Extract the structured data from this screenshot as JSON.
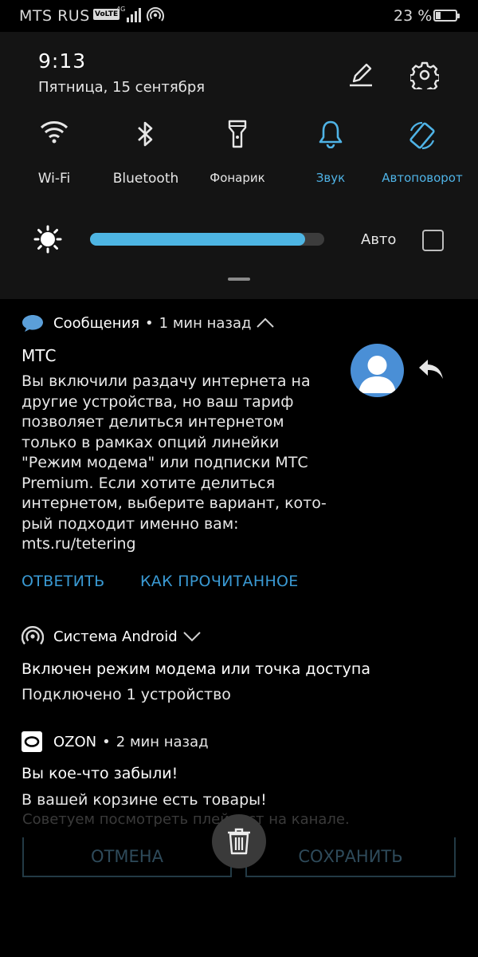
{
  "status_bar": {
    "carrier": "MTS RUS",
    "volte": "VoLTE",
    "network": "4G",
    "battery_percent": "23 %",
    "battery_level": 0.23
  },
  "quick_settings": {
    "time": "9:13",
    "date": "Пятница, 15 сентября",
    "tiles": [
      {
        "label": "Wi-Fi",
        "icon": "wifi-icon",
        "active": false
      },
      {
        "label": "Bluetooth",
        "icon": "bluetooth-icon",
        "active": false
      },
      {
        "label": "Фонарик",
        "icon": "flashlight-icon",
        "active": false
      },
      {
        "label": "Звук",
        "icon": "bell-icon",
        "active": true
      },
      {
        "label": "Автоповорот",
        "icon": "auto-rotate-icon",
        "active": true
      }
    ],
    "brightness_level": 0.92,
    "auto_label": "Авто",
    "auto_checked": false
  },
  "notifications": {
    "sms": {
      "app": "Сообщения",
      "time": "1 мин назад",
      "sender": "МТС",
      "body": "Вы включили раздачу интернета на другие устройства, но ваш тариф позволяет делиться интернетом только в рамках опций линейки \"Режим модема\" или подписки МТС Premium. Если хотите делиться интернетом, выберите вариант, кото-рый подходит именно вам: mts.ru/tetering",
      "actions": [
        "ОТВЕТИТЬ",
        "КАК ПРОЧИТАННОЕ"
      ]
    },
    "android": {
      "app": "Система Android",
      "title": "Включен режим модема или точка доступа",
      "text": "Подключено 1 устройство"
    },
    "ozon": {
      "app": "OZON",
      "time": "2 мин назад",
      "title": "Вы кое-что забыли!",
      "text": "В вашей корзине есть товары!"
    }
  },
  "background_app": {
    "ghost_text": "Советуем посмотреть плейлист на канале.",
    "cancel_label": "ОТМЕНА",
    "save_label": "СОХРАНИТЬ"
  },
  "colors": {
    "accent": "#4fb3e6",
    "action": "#3a9ad4",
    "panel": "#141414"
  }
}
